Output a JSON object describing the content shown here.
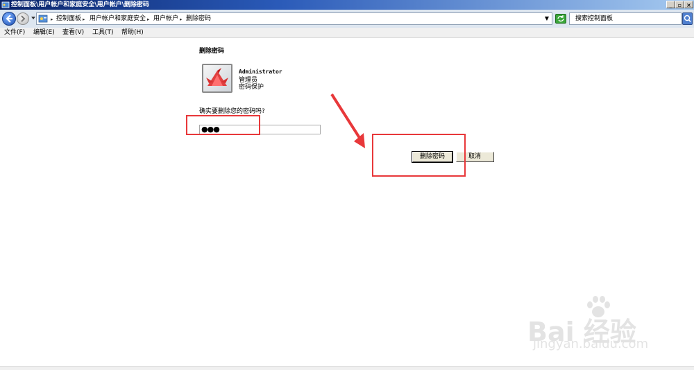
{
  "window": {
    "title": "控制面板\\用户帐户和家庭安全\\用户帐户\\删除密码"
  },
  "address_bar": {
    "breadcrumbs": [
      "控制面板",
      "用户帐户和家庭安全",
      "用户帐户",
      "删除密码"
    ],
    "separator": "▸",
    "search_placeholder": "搜索控制面板"
  },
  "menu": {
    "items": [
      "文件(F)",
      "编辑(E)",
      "查看(V)",
      "工具(T)",
      "帮助(H)"
    ]
  },
  "page": {
    "title": "删除密码",
    "account_name": "Administrator",
    "account_role": "管理员",
    "account_status": "密码保护",
    "question": "确实要删除您的密码吗?",
    "password_mask": "●●●",
    "delete_button": "删除密码",
    "cancel_button": "取消"
  },
  "watermark": {
    "main": "Bai 经验",
    "sub": "jingyan.baidu.com"
  },
  "colors": {
    "annotation": "#e8383a",
    "titlebar": "#0a246a"
  }
}
